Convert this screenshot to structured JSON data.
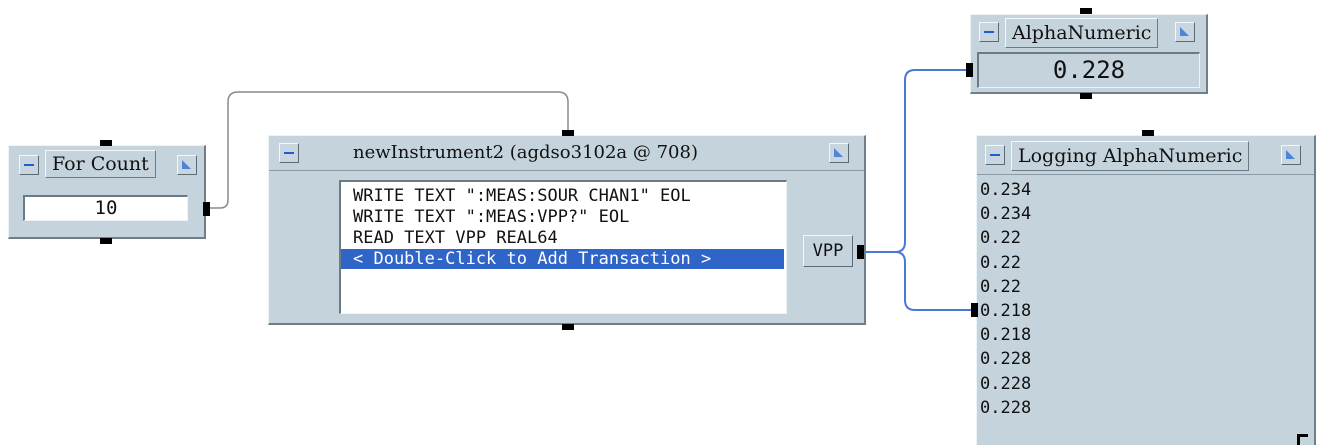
{
  "for_count": {
    "title": "For Count",
    "value": "10"
  },
  "instrument": {
    "title": "newInstrument2 (agdso3102a @ 708)",
    "transactions": [
      "WRITE TEXT \":MEAS:SOUR CHAN1\" EOL",
      "WRITE TEXT \":MEAS:VPP?\" EOL",
      "READ TEXT VPP REAL64"
    ],
    "add_transaction_label": "< Double-Click to Add Transaction >",
    "output_terminal": "VPP"
  },
  "alphanumeric": {
    "title": "AlphaNumeric",
    "value": "0.228"
  },
  "logging": {
    "title": "Logging AlphaNumeric",
    "values": [
      "0.234",
      "0.234",
      "0.22",
      "0.22",
      "0.22",
      "0.218",
      "0.218",
      "0.228",
      "0.228",
      "0.228"
    ]
  },
  "colors": {
    "wire_control": "#8a8a8a",
    "wire_data": "#4a78d8",
    "selection": "#2f64c9"
  }
}
